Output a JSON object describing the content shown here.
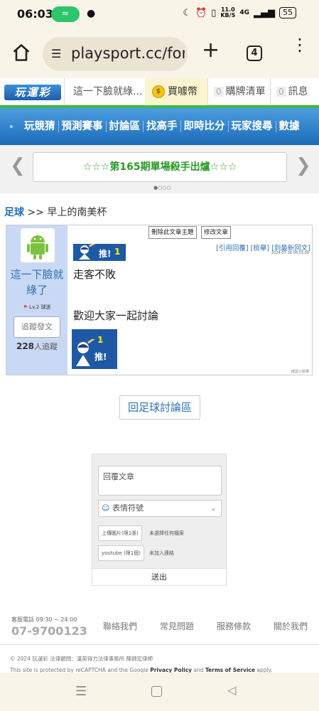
{
  "status_bar": {
    "time": "06:03",
    "net_speed_value": "11.0",
    "net_speed_unit": "KB/S",
    "signal": "4G",
    "battery": "55"
  },
  "browser": {
    "url": "playsport.cc/for",
    "tab_count": "4"
  },
  "top_nav": {
    "logo": "玩運彩",
    "username": "這一下臉就綠...",
    "coin_label": "買噱幣",
    "cart_count": "0",
    "cart_label": "購牌清單",
    "msg_count": "0",
    "msg_label": "訊息"
  },
  "main_nav": {
    "items": [
      "玩競猜",
      "預測賽事",
      "討論區",
      "找高手",
      "即時比分",
      "玩家搜尋",
      "數據"
    ]
  },
  "banner": {
    "text": "☆☆☆第165期單場殺手出爐☆☆☆"
  },
  "breadcrumb": {
    "sport": "足球",
    "sep": ">>",
    "title": "早上的南美杯"
  },
  "post": {
    "author": "這一下臉就綠了",
    "level": "Lv.2 球迷",
    "follow_label": "追蹤發文",
    "follow_count": "228",
    "follow_suffix": "人追蹤",
    "delete_label": "刪除此文章主題",
    "edit_label": "修改文章",
    "push_label": "推!",
    "push_count": "1",
    "action_quote": "[引用回覆]",
    "action_report": "[檢舉]",
    "action_latest": "[到最新回文]",
    "date": "2024-07-18 06:03:06",
    "body_line1": "走客不敗",
    "body_line2": "歡迎大家一起討論",
    "report_note": "確認小檢舉"
  },
  "back_button": "回足球討論區",
  "reply_form": {
    "textarea_placeholder": "回覆文章",
    "emoji_label": "表情符號",
    "upload_label": "上傳圖片(限1張)",
    "upload_note": "未選擇任何檔案",
    "youtube_label": "youtube (限1個)",
    "youtube_note": "未加入連結",
    "submit_label": "送出"
  },
  "footer": {
    "phone_label": "客服電話 09:30 ~ 24:00",
    "phone": "07-9700123",
    "links": [
      "聯絡我們",
      "常見問題",
      "服務條款",
      "關於我們"
    ],
    "copyright": "© 2024 玩運彩 法律顧問：漢英得力法律事務所 陳錦宏律師",
    "recaptcha_prefix": "This site is protected by reCAPTCHA and the Google",
    "privacy": "Privacy Policy",
    "and": "and",
    "terms": "Terms of Service",
    "apply": "apply."
  },
  "colors": {
    "nav_blue": "#1c6cb8",
    "link_blue": "#2e6fb5",
    "accent_green": "#3fb74a",
    "sidebar_bg": "#c9d9f5"
  }
}
